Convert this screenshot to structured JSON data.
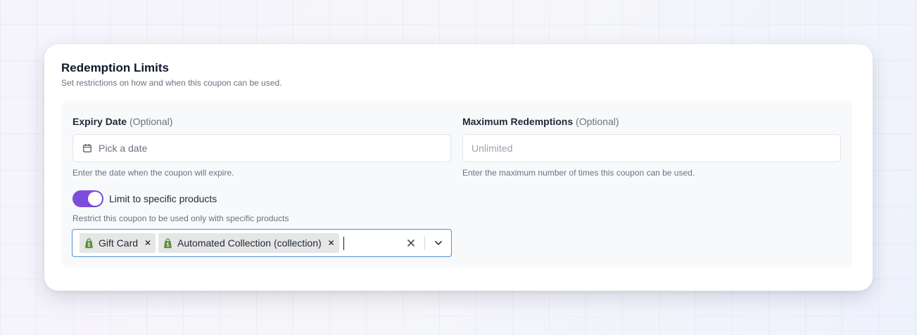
{
  "section": {
    "title": "Redemption Limits",
    "subtitle": "Set restrictions on how and when this coupon can be used."
  },
  "expiry": {
    "label": "Expiry Date",
    "optional": "(Optional)",
    "placeholder": "Pick a date",
    "hint": "Enter the date when the coupon will expire.",
    "icon": "calendar-icon"
  },
  "max_redemptions": {
    "label": "Maximum Redemptions",
    "optional": "(Optional)",
    "placeholder": "Unlimited",
    "hint": "Enter the maximum number of times this coupon can be used."
  },
  "products": {
    "toggle_label": "Limit to specific products",
    "toggle_on": true,
    "hint": "Restrict this coupon to be used only with specific products",
    "selected": [
      {
        "label": "Gift Card",
        "icon": "shopify-bag-icon"
      },
      {
        "label": "Automated Collection (collection)",
        "icon": "shopify-bag-icon"
      }
    ]
  },
  "colors": {
    "accent": "#7c4ddb",
    "focus_border": "#4d8fdc",
    "shopify_green": "#5e8e3e"
  }
}
